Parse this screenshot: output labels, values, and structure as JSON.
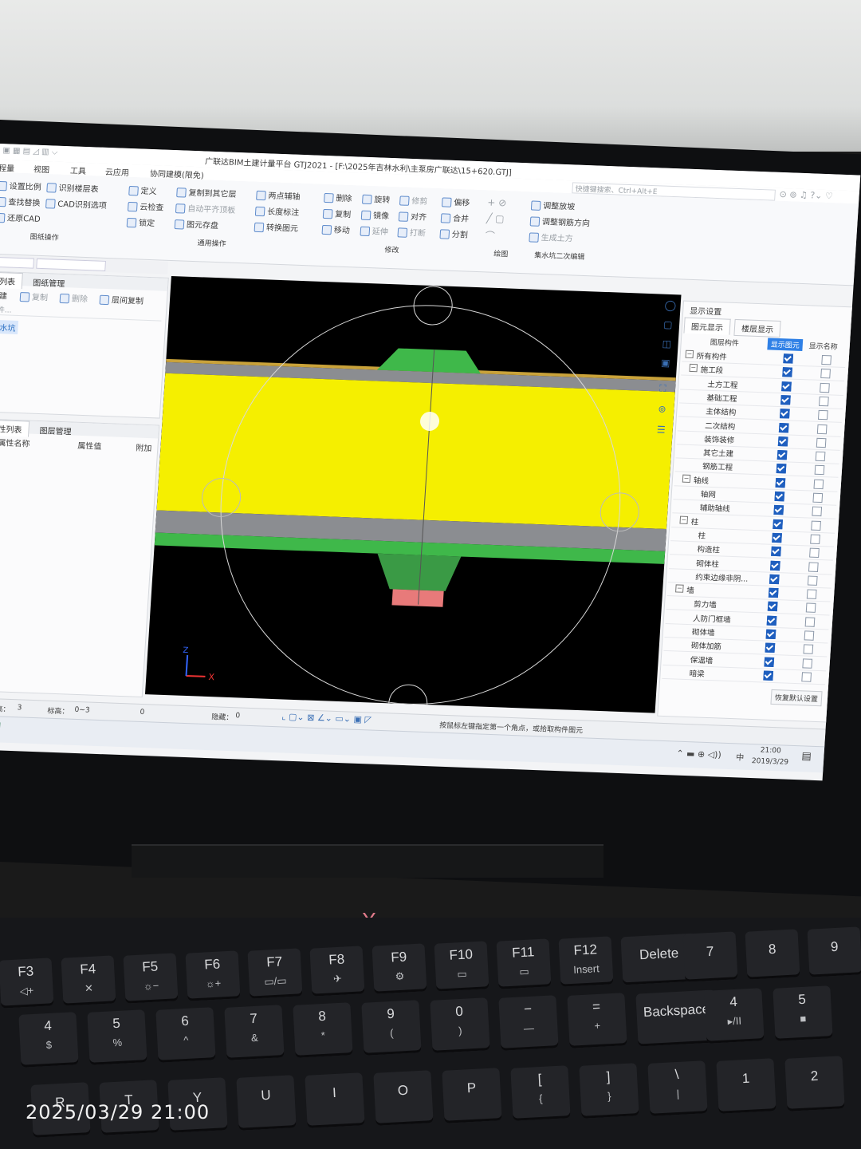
{
  "window": {
    "title": "广联达BIM土建计量平台 GTJ2021 - [F:\\2025年吉林水利\\主泵房广联达\\15+620.GTJ]",
    "search_placeholder": "快捷键搜索、Ctrl+Alt+E"
  },
  "menu": [
    "程量",
    "视图",
    "工具",
    "云应用",
    "协同建模(限免)"
  ],
  "ribbon": {
    "g1": [
      "设置比例",
      "识别楼层表",
      "查找替换",
      "CAD识别选项",
      "还原CAD"
    ],
    "g1_label": "图纸操作",
    "g2": [
      "定义",
      "复制到其它层",
      "两点辅轴",
      "云检查",
      "自动平齐顶板",
      "长度标注",
      "锁定",
      "图元存盘",
      "转换图元"
    ],
    "g2_label": "通用操作",
    "g3": [
      "删除",
      "旋转",
      "修剪",
      "偏移",
      "复制",
      "镜像",
      "对齐",
      "合并",
      "移动",
      "延伸",
      "打断",
      "分割"
    ],
    "g3_label": "修改",
    "g4_label": "绘图",
    "g5": [
      "调整放坡",
      "调整钢筋方向",
      "生成土方"
    ],
    "g5_label": "集水坑二次编辑"
  },
  "left_panel": {
    "tabs": [
      "列表",
      "图纸管理"
    ],
    "actions": [
      "新建",
      "复制",
      "删除",
      "层间复制"
    ],
    "search_placeholder": "构件...",
    "selected_item": "集水坑",
    "prop_tabs": [
      "属性列表",
      "图层管理"
    ],
    "prop_headers": [
      "属性名称",
      "属性值",
      "附加"
    ]
  },
  "right_panel": {
    "title": "显示设置",
    "tabs": [
      "图元显示",
      "楼层显示"
    ],
    "headers": [
      "图层构件",
      "显示图元",
      "显示名称"
    ],
    "rows": [
      {
        "label": "所有构件",
        "level": 0,
        "group": true,
        "show": true,
        "name": false
      },
      {
        "label": "施工段",
        "level": 1,
        "group": true,
        "show": true,
        "name": false
      },
      {
        "label": "土方工程",
        "level": 2,
        "group": false,
        "show": true,
        "name": false
      },
      {
        "label": "基础工程",
        "level": 2,
        "group": false,
        "show": true,
        "name": false
      },
      {
        "label": "主体结构",
        "level": 2,
        "group": false,
        "show": true,
        "name": false
      },
      {
        "label": "二次结构",
        "level": 2,
        "group": false,
        "show": true,
        "name": false
      },
      {
        "label": "装饰装修",
        "level": 2,
        "group": false,
        "show": true,
        "name": false
      },
      {
        "label": "其它土建",
        "level": 2,
        "group": false,
        "show": true,
        "name": false
      },
      {
        "label": "钢筋工程",
        "level": 2,
        "group": false,
        "show": true,
        "name": false
      },
      {
        "label": "轴线",
        "level": 1,
        "group": true,
        "show": true,
        "name": false
      },
      {
        "label": "轴网",
        "level": 2,
        "group": false,
        "show": true,
        "name": false
      },
      {
        "label": "辅助轴线",
        "level": 2,
        "group": false,
        "show": true,
        "name": false
      },
      {
        "label": "柱",
        "level": 1,
        "group": true,
        "show": true,
        "name": false
      },
      {
        "label": "柱",
        "level": 2,
        "group": false,
        "show": true,
        "name": false
      },
      {
        "label": "构造柱",
        "level": 2,
        "group": false,
        "show": true,
        "name": false
      },
      {
        "label": "砌体柱",
        "level": 2,
        "group": false,
        "show": true,
        "name": false
      },
      {
        "label": "约束边缘非阴...",
        "level": 2,
        "group": false,
        "show": true,
        "name": false
      },
      {
        "label": "墙",
        "level": 1,
        "group": true,
        "show": true,
        "name": false
      },
      {
        "label": "剪力墙",
        "level": 2,
        "group": false,
        "show": true,
        "name": false
      },
      {
        "label": "人防门框墙",
        "level": 2,
        "group": false,
        "show": true,
        "name": false
      },
      {
        "label": "砌体墙",
        "level": 2,
        "group": false,
        "show": true,
        "name": false
      },
      {
        "label": "砌体加筋",
        "level": 2,
        "group": false,
        "show": true,
        "name": false
      },
      {
        "label": "保温墙",
        "level": 2,
        "group": false,
        "show": true,
        "name": false
      },
      {
        "label": "暗梁",
        "level": 2,
        "group": false,
        "show": true,
        "name": false
      }
    ],
    "restore_button": "恢复默认设置"
  },
  "viewport": {
    "axis_x": "X",
    "axis_z": "Z",
    "colors": {
      "slab": "#f5ef00",
      "gray": "#8b8d91",
      "green": "#3fb84a",
      "pit_bottom": "#e87a7a",
      "bg": "#000000"
    }
  },
  "status": {
    "floor_height_label": "层高：",
    "floor_height": "3",
    "elevation_label": "标高：",
    "elevation": "0~3",
    "zero": "0",
    "hidden_label": "隐藏：",
    "hidden": "0",
    "hint": "按鼠标左键指定第一个角点，或拾取构件图元"
  },
  "taskbar": {
    "time": "21:00",
    "date": "2019/3/29",
    "ime": "中"
  },
  "keyboard": {
    "frow": [
      {
        "m": "F3",
        "s": "◁+"
      },
      {
        "m": "F4",
        "s": "✕"
      },
      {
        "m": "F5",
        "s": "☼−"
      },
      {
        "m": "F6",
        "s": "☼+"
      },
      {
        "m": "F7",
        "s": "▭/▭"
      },
      {
        "m": "F8",
        "s": "✈"
      },
      {
        "m": "F9",
        "s": "⚙"
      },
      {
        "m": "F10",
        "s": "▭"
      },
      {
        "m": "F11",
        "s": "▭"
      },
      {
        "m": "F12",
        "s": "Insert"
      },
      {
        "m": "Delete",
        "s": ""
      },
      {
        "m": "7",
        "s": ""
      },
      {
        "m": "8",
        "s": ""
      },
      {
        "m": "9",
        "s": ""
      }
    ],
    "nrow": [
      {
        "m": "4",
        "s": "$"
      },
      {
        "m": "5",
        "s": "%"
      },
      {
        "m": "6",
        "s": "^"
      },
      {
        "m": "7",
        "s": "&"
      },
      {
        "m": "8",
        "s": "*"
      },
      {
        "m": "9",
        "s": "("
      },
      {
        "m": "0",
        "s": ")"
      },
      {
        "m": "−",
        "s": "—"
      },
      {
        "m": "=",
        "s": "+"
      },
      {
        "m": "Backspace",
        "s": ""
      },
      {
        "m": "4",
        "s": "▸/II"
      },
      {
        "m": "5",
        "s": "■"
      }
    ],
    "lrow": [
      {
        "m": "R",
        "s": ""
      },
      {
        "m": "T",
        "s": ""
      },
      {
        "m": "Y",
        "s": ""
      },
      {
        "m": "U",
        "s": ""
      },
      {
        "m": "I",
        "s": ""
      },
      {
        "m": "O",
        "s": ""
      },
      {
        "m": "P",
        "s": ""
      },
      {
        "m": "[",
        "s": "{"
      },
      {
        "m": "]",
        "s": "}"
      },
      {
        "m": "\\",
        "s": "|"
      },
      {
        "m": "1",
        "s": ""
      },
      {
        "m": "2",
        "s": ""
      }
    ]
  },
  "photo_timestamp": "2025/03/29 21:00"
}
